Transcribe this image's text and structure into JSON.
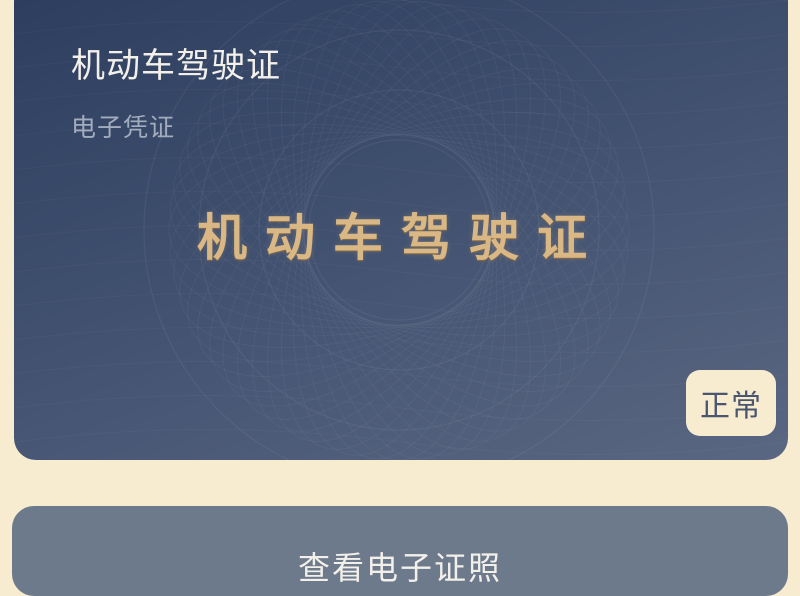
{
  "card": {
    "title": "机动车驾驶证",
    "subtitle": "电子凭证",
    "emblem_text": "机动车驾驶证",
    "status": "正常"
  },
  "actions": {
    "view_label": "查看电子证照"
  },
  "colors": {
    "background": "#f8ecd0",
    "card_dark": "#2c3d5e",
    "card_light": "#5a6782",
    "emblem_gold": "#d9b886",
    "button": "#6d7a8c"
  }
}
